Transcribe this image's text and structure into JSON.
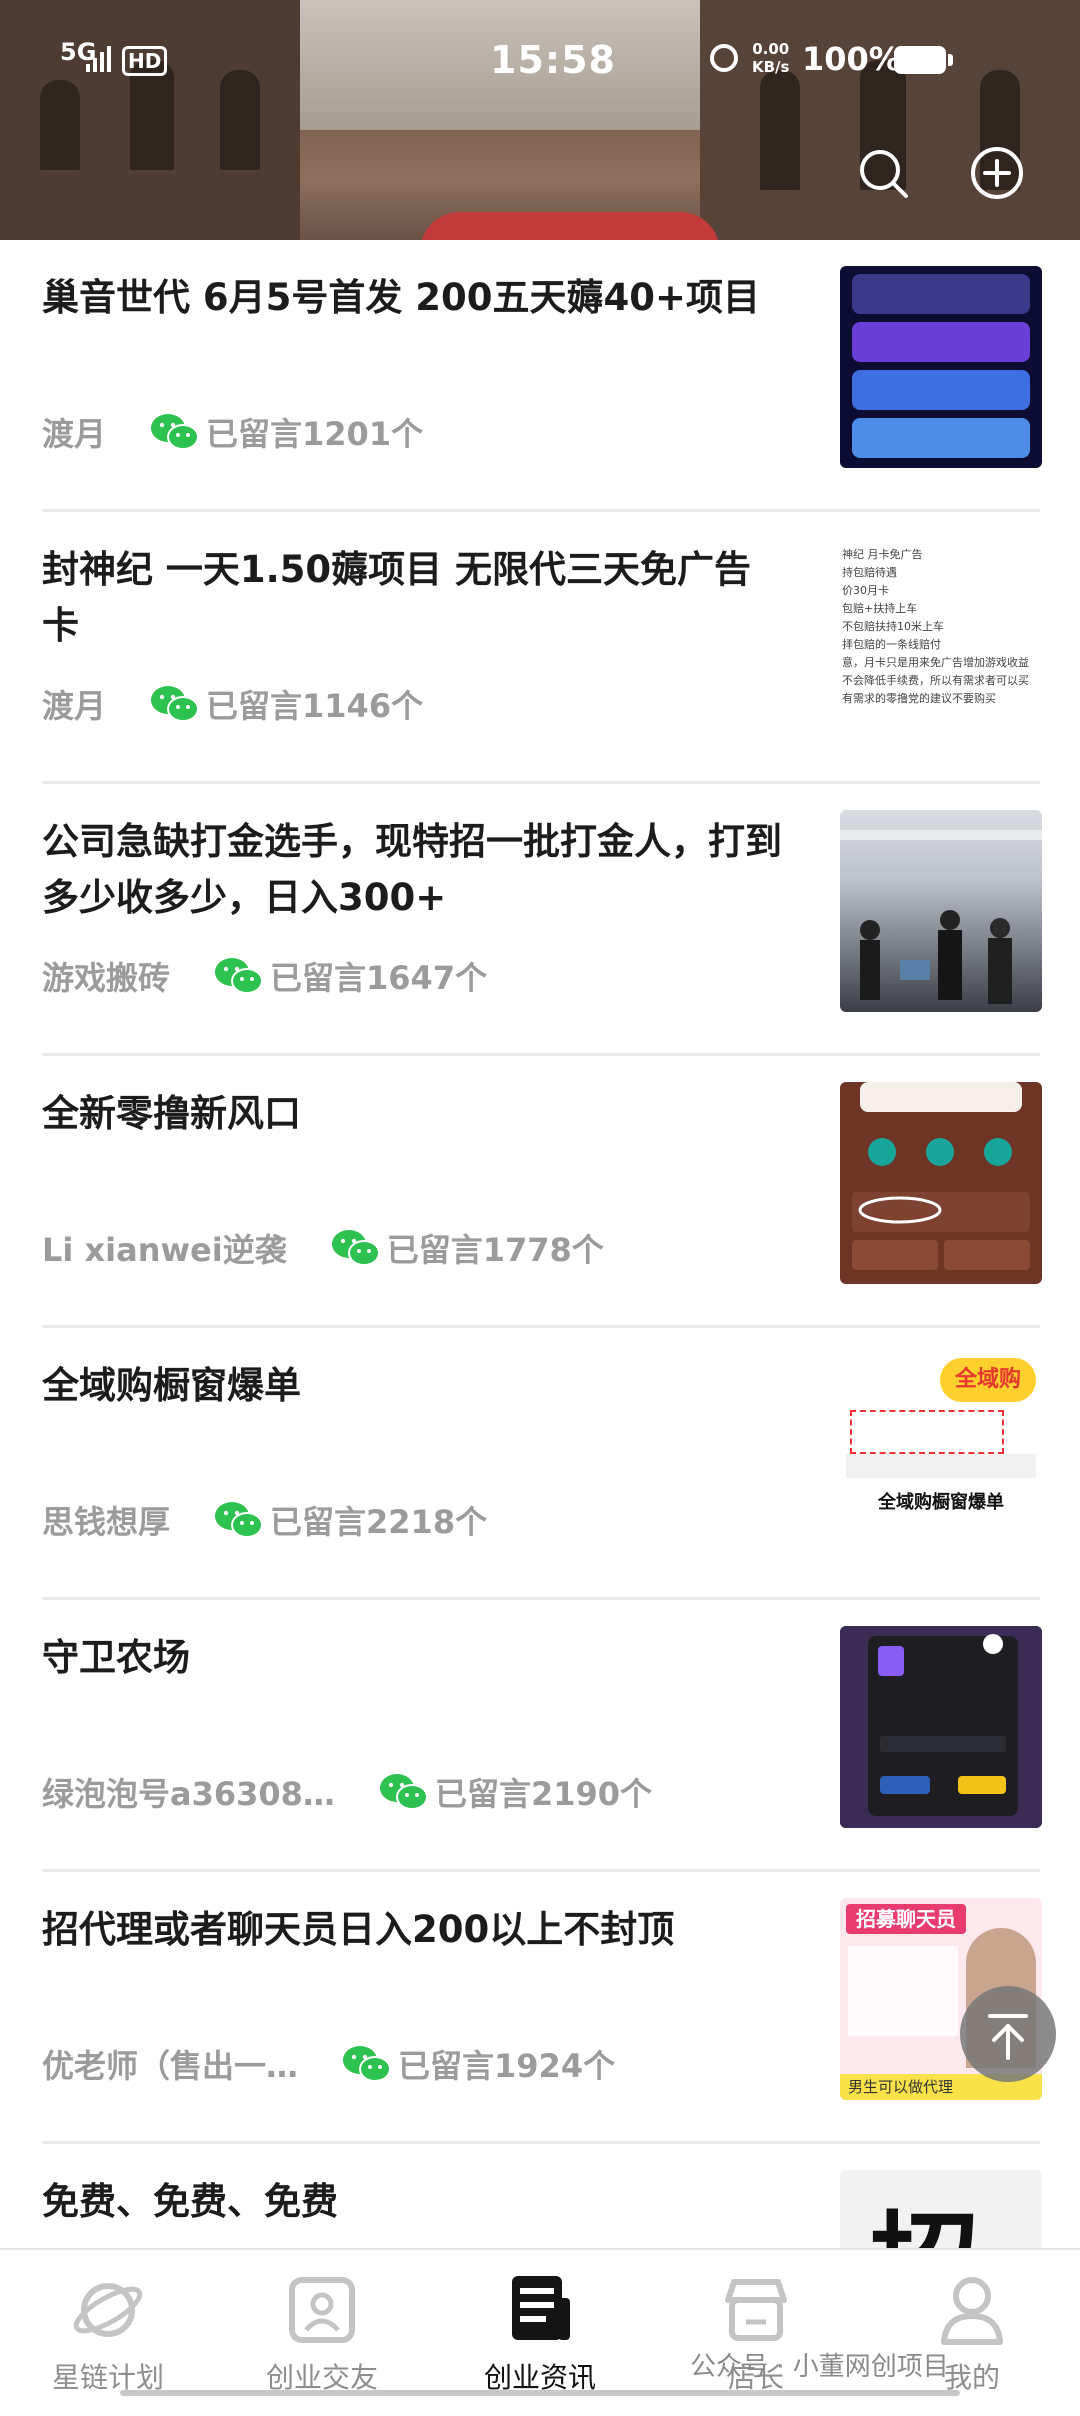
{
  "status_bar": {
    "network": "5G",
    "hd": "HD",
    "time": "15:58",
    "speed_value": "0.00",
    "speed_unit": "KB/s",
    "battery": "100%"
  },
  "header": {
    "search_icon": "search-icon",
    "add_icon": "plus-circle-icon"
  },
  "feed": [
    {
      "title": "巢音世代 6月5号首发 200五天薅40+项目",
      "author": "渡月",
      "comments": "已留言1201个"
    },
    {
      "title": "封神纪 一天1.50薅项目 无限代三天免广告卡",
      "author": "渡月",
      "comments": "已留言1146个",
      "thumb_lines": [
        "神纪      月卡免广告",
        "持包赔待遇",
        "",
        "价30月卡",
        " 包赔+扶持上车",
        " 不包赔扶持10米上车",
        "拝包赔的一条线赔付",
        "意，月卡只是用来免广告增加游戏收益",
        "不会降低手续费，所以有需求者可以买",
        "有需求的零撸党的建议不要购买"
      ]
    },
    {
      "title": "公司急缺打金选手，现特招一批打金人，打到多少收多少，日入300+",
      "author": "游戏搬砖",
      "comments": "已留言1647个"
    },
    {
      "title": "全新零撸新风口",
      "author": "Li xianwei逆袭",
      "comments": "已留言1778个"
    },
    {
      "title": "全域购橱窗爆单",
      "author": "思钱想厚",
      "comments": "已留言2218个",
      "thumb_banner": "全域购橱窗爆单",
      "thumb_badge": "全域购"
    },
    {
      "title": "守卫农场",
      "author": "绿泡泡号a36308…",
      "comments": "已留言2190个"
    },
    {
      "title": "招代理或者聊天员日入200以上不封顶",
      "author": "优老师（售出一…",
      "comments": "已留言1924个",
      "thumb_banner": "招募聊天员",
      "thumb_footer": "男生可以做代理"
    },
    {
      "title": "免费、免费、免费",
      "author": "",
      "comments": "",
      "thumb_banner": "招"
    }
  ],
  "bottom_nav": [
    {
      "label": "星链计划",
      "icon": "planet-icon",
      "active": false
    },
    {
      "label": "创业交友",
      "icon": "contact-card-icon",
      "active": false
    },
    {
      "label": "创业资讯",
      "icon": "document-icon",
      "active": true
    },
    {
      "label": "店长",
      "icon": "store-icon",
      "active": false
    },
    {
      "label": "我的",
      "icon": "user-icon",
      "active": false
    }
  ],
  "watermark": "公众号 · 小董网创项目",
  "colors": {
    "wechat_green": "#2dc24f",
    "meta_gray": "#9b9b9b",
    "title": "#1c1c1c"
  }
}
